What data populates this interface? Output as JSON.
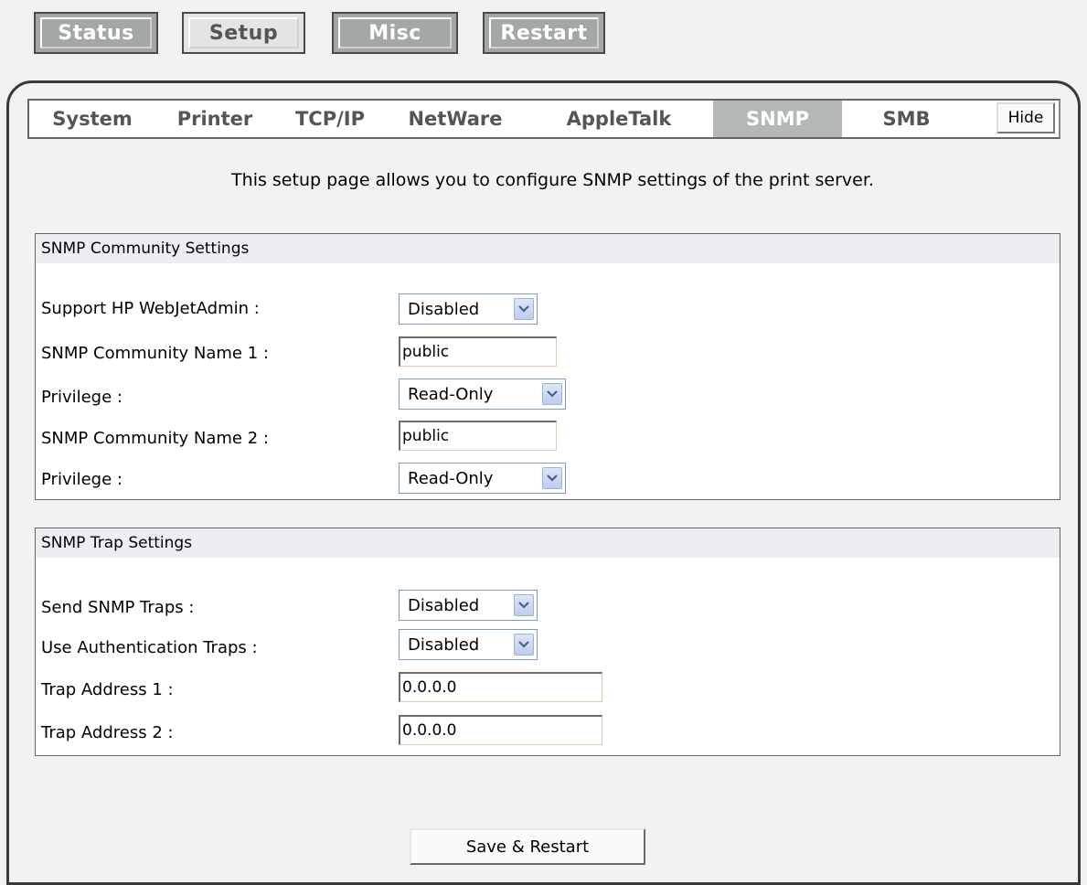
{
  "top_buttons": [
    {
      "label": "Status"
    },
    {
      "label": "Setup"
    },
    {
      "label": "Misc"
    },
    {
      "label": "Restart"
    }
  ],
  "tabs": [
    {
      "label": "System"
    },
    {
      "label": "Printer"
    },
    {
      "label": "TCP/IP"
    },
    {
      "label": "NetWare"
    },
    {
      "label": "AppleTalk"
    },
    {
      "label": "SNMP"
    },
    {
      "label": "SMB"
    }
  ],
  "active_tab": "SNMP",
  "hide_label": "Hide",
  "description": "This setup page allows you to configure SNMP settings of the print server.",
  "community": {
    "title": "SNMP Community Settings",
    "support_hp_label": "Support HP WebJetAdmin :",
    "support_hp_value": "Disabled",
    "name1_label": "SNMP Community Name 1 :",
    "name1_value": "public",
    "priv1_label": "Privilege :",
    "priv1_value": "Read-Only",
    "name2_label": "SNMP Community Name 2 :",
    "name2_value": "public",
    "priv2_label": "Privilege :",
    "priv2_value": "Read-Only"
  },
  "trap": {
    "title": "SNMP Trap Settings",
    "send_label": "Send SNMP Traps :",
    "send_value": "Disabled",
    "auth_label": "Use Authentication Traps :",
    "auth_value": "Disabled",
    "addr1_label": "Trap Address 1 :",
    "addr1_value": "0.0.0.0",
    "addr2_label": "Trap Address 2 :",
    "addr2_value": "0.0.0.0"
  },
  "save_label": "Save & Restart",
  "colors": {
    "top_button_bg": "#a4a8a4",
    "active_tab_bg": "#b4b8b4",
    "section_title_bg": "#efedf2"
  }
}
